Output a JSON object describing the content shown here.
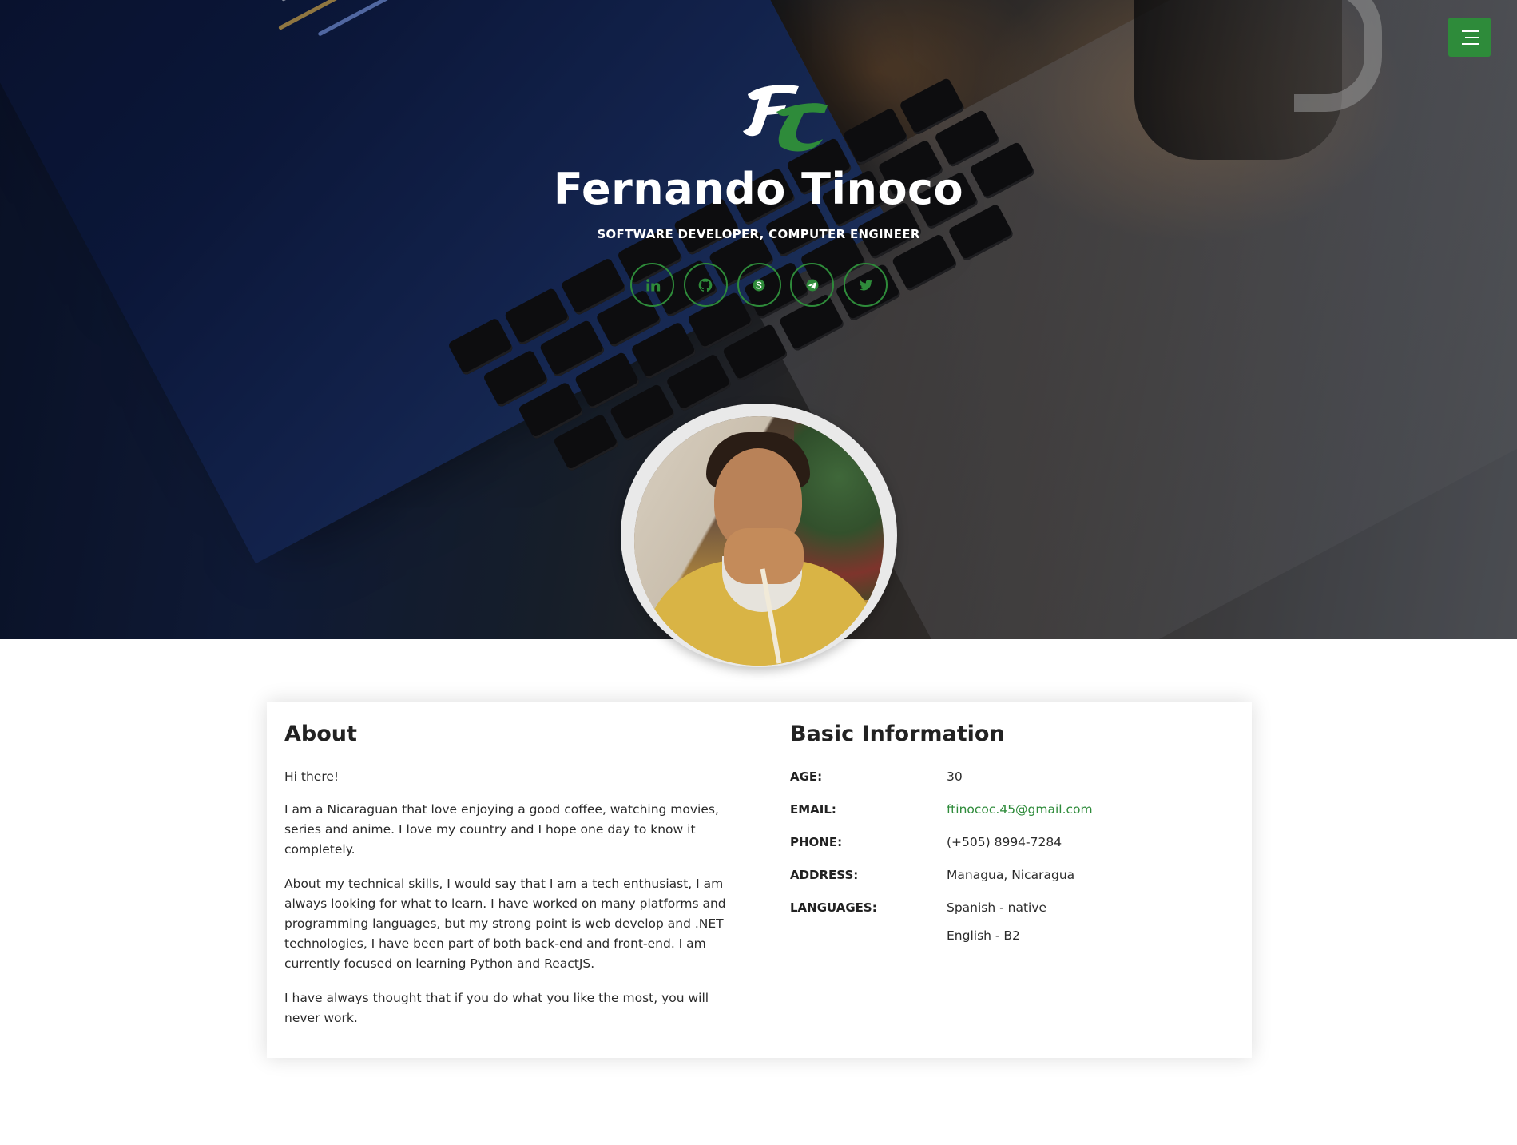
{
  "header": {
    "menu_icon": "hamburger-menu-icon",
    "logo_icon": "ft-monogram-logo",
    "name": "Fernando Tinoco",
    "role": "SOFTWARE DEVELOPER, COMPUTER ENGINEER",
    "socials": [
      {
        "network": "LinkedIn",
        "icon": "linkedin-icon"
      },
      {
        "network": "GitHub",
        "icon": "github-icon"
      },
      {
        "network": "Skype",
        "icon": "skype-icon"
      },
      {
        "network": "Telegram",
        "icon": "telegram-icon"
      },
      {
        "network": "Twitter",
        "icon": "twitter-icon"
      }
    ]
  },
  "about": {
    "title": "About",
    "paragraphs": [
      "Hi there!",
      "I am a Nicaraguan that love enjoying a good coffee, watching movies, series and anime. I love my country and I hope one day to know it completely.",
      "About my technical skills, I would say that I am a tech enthusiast, I am always looking for what to learn. I have worked on many platforms and programming languages, but my strong point is web develop and .NET technologies, I have been part of both back-end and front-end. I am currently focused on learning Python and ReactJS.",
      "I have always thought that if you do what you like the most, you will never work."
    ]
  },
  "basic_info": {
    "title": "Basic Information",
    "age_label": "AGE:",
    "age": "30",
    "email_label": "EMAIL:",
    "email": "ftinococ.45@gmail.com",
    "phone_label": "PHONE:",
    "phone": "(+505) 8994-7284",
    "address_label": "ADDRESS:",
    "address": "Managua, Nicaragua",
    "languages_label": "LANGUAGES:",
    "languages": [
      "Spanish - native",
      "English - B2"
    ]
  },
  "colors": {
    "accent": "#2e8b3a",
    "hero_text": "#ffffff",
    "body_text": "#2b2b2b"
  }
}
